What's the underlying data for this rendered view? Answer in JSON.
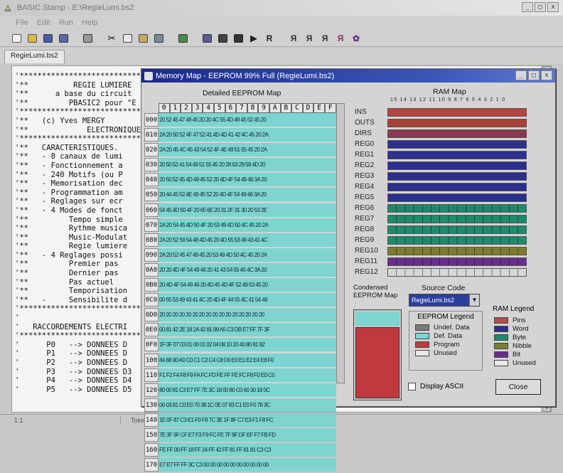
{
  "window": {
    "title": "BASIC Stamp - E:\\RegieLumi.bs2",
    "min": "_",
    "max": "□",
    "close": "x"
  },
  "menu": [
    "File",
    "Edit",
    "Run",
    "Help"
  ],
  "tab": "RegieLumi.bs2",
  "code_lines": [
    "'*****************************************",
    "'**          REGIE LUMIERE",
    "'**      a base du circuit",
    "'**         PBASIC2 pour \"E",
    "'*****************************************",
    "'**   (c) Yves MERGY",
    "'**             ELECTRONIQUE",
    "'*****************************************",
    "'**   CARACTERISTIQUES.",
    "'**   - 8 canaux de lumi",
    "'**   - Fonctionnement a",
    "'**   - 240 Motifs (ou P",
    "'**   - Memorisation dec",
    "'**   - Programmation am",
    "'**   - Reglages sur ecr",
    "'**   - 4 Modes de fonct",
    "'**         Tempo simple",
    "'**         Rythme musica",
    "'**         Music-Modulat",
    "'**         Regie lumiere",
    "'**   - 4 Reglages possi",
    "'**         Premier pas",
    "'**         Dernier pas",
    "'**         Pas actuel",
    "'**         Temporisation",
    "'**   -     Sensibilite d",
    "'*****************************************",
    "'",
    "'   RACCORDEMENTS ELECTRI",
    "'*****************************************",
    "'      P0   --> DONNEES D",
    "'      P1   --> DONNEES D",
    "'      P2   --> DONNEES D",
    "'      P3   --> DONNEES D3",
    "'      P4   --> DONNEES D4",
    "'      P5   --> DONNEES D5"
  ],
  "status": {
    "position": "1:1",
    "message": "Tokenize Successful"
  },
  "dialog": {
    "title": "Memory Map - EEPROM 99% Full (RegieLumi.bs2)",
    "detailed_label": "Detailed EEPROM Map",
    "ram_label": "RAM Map",
    "condensed_label": "Condensed EEPROM Map",
    "source_label": "Source Code",
    "source_value": "RegieLumi.bs2",
    "display_ascii": "Display ASCII",
    "close": "Close",
    "hex_columns": [
      "0",
      "1",
      "2",
      "3",
      "4",
      "5",
      "6",
      "7",
      "8",
      "9",
      "A",
      "B",
      "C",
      "D",
      "E",
      "F"
    ],
    "hex_rows": [
      {
        "addr": "000",
        "bytes": "20 52 45 47 49 45 20 20 4C 55 4D 49 45 52 45 20"
      },
      {
        "addr": "010",
        "bytes": "2A 20 50 52 4F 47 52 41 4D 4D 41 42 4C 45 20 2A"
      },
      {
        "addr": "020",
        "bytes": "2A 20 45 4C 45 43 54 52 4F 4E 49 51 55 45 20 2A"
      },
      {
        "addr": "030",
        "bytes": "20 50 52 41 54 49 51 55 45 20 28 63 29 59 4D 20"
      },
      {
        "addr": "040",
        "bytes": "20 50 52 45 4D 49 45 52 20 4D 4F 54 49 46 3A 20"
      },
      {
        "addr": "050",
        "bytes": "20 44 45 52 4E 49 45 52 20 4D 4F 54 49 46 3A 20"
      },
      {
        "addr": "060",
        "bytes": "54 45 4D 50 4F 20 65 6E 20 31 2F 31 30 20 53 2E"
      },
      {
        "addr": "070",
        "bytes": "2A 20 54 45 4D 50 4F 20 53 49 4D 50 4C 45 20 2A"
      },
      {
        "addr": "080",
        "bytes": "2A 20 52 59 54 48 4D 45 20 4D 55 53 49 43 41 4C"
      },
      {
        "addr": "090",
        "bytes": "2A 20 52 45 47 49 45 20 53 49 4D 50 4C 45 20 2A"
      },
      {
        "addr": "0A0",
        "bytes": "20 20 4D 4F 54 49 46 20 41 43 54 55 45 4C 3A 20"
      },
      {
        "addr": "0B0",
        "bytes": "20 4D 4F 54 49 46 20 4D 45 4D 4F 52 49 53 45 20"
      },
      {
        "addr": "0C0",
        "bytes": "00 55 53 49 43 41 4C 20 4D 4F 44 55 4C 41 54 49"
      },
      {
        "addr": "0D0",
        "bytes": "20 20 20 20 20 20 20 20 20 20 20 20 20 20 20 20"
      },
      {
        "addr": "0E0",
        "bytes": "00 81 42 2E 18 2A 42 81 99 A5 C3 DB E7 FF 7F 3F"
      },
      {
        "addr": "0F0",
        "bytes": "1F 0F 07 03 01 00 01 02 04 08 10 20 40 80 81 82"
      },
      {
        "addr": "100",
        "bytes": "84 88 90 A0 C0 C1 C2 C4 C8 D0 E0 E1 E2 E4 E8 F0"
      },
      {
        "addr": "110",
        "bytes": "F1 F2 F4 F8 F9 FA FC FD FE FF FE FC F8 F0 E0 C0"
      },
      {
        "addr": "120",
        "bytes": "80 00 81 C3 E7 FF 7E 3C 18 00 80 C0 60 30 18 0C"
      },
      {
        "addr": "130",
        "bytes": "06 03 81 C0 E0 70 38 1C 0E 07 83 C1 E0 F0 78 3C"
      },
      {
        "addr": "140",
        "bytes": "1E 0F 87 C3 E1 F0 F8 7C 3E 1F 8F C7 E3 F1 F8 FC"
      },
      {
        "addr": "150",
        "bytes": "7E 3F 9F CF E7 F3 F9 FC FE 7F 9F DF EF F7 FB FD"
      },
      {
        "addr": "160",
        "bytes": "FE FF 00 FF 18 FF 24 FF 42 FF 81 FF 81 81 C3 C3"
      },
      {
        "addr": "170",
        "bytes": "E7 E7 FF FF 3C C3 00 00 00 00 00 00 00 00 00 00"
      }
    ],
    "ram_bit_numbers": "15 14 13 12 11 10 9 8 7 6 5 4 3 2 1 0",
    "ram_rows": [
      {
        "label": "INS",
        "color": "#b8443f",
        "cells": false
      },
      {
        "label": "OUTS",
        "color": "#a84238",
        "cells": false
      },
      {
        "label": "DIRS",
        "color": "#8a3a4e",
        "cells": false
      },
      {
        "label": "REG0",
        "color": "#2b2f8e",
        "cells": false
      },
      {
        "label": "REG1",
        "color": "#2b2f8e",
        "cells": false
      },
      {
        "label": "REG2",
        "color": "#2b2f8e",
        "cells": false
      },
      {
        "label": "REG3",
        "color": "#2b2f8e",
        "cells": false
      },
      {
        "label": "REG4",
        "color": "#2b2f8e",
        "cells": false
      },
      {
        "label": "REG5",
        "color": "#2b2f8e",
        "cells": false
      },
      {
        "label": "REG6",
        "color": "#1f8a6e",
        "cells": true
      },
      {
        "label": "REG7",
        "color": "#1f8a6e",
        "cells": true
      },
      {
        "label": "REG8",
        "color": "#1f8a6e",
        "cells": true
      },
      {
        "label": "REG9",
        "color": "#1f8a6e",
        "cells": true
      },
      {
        "label": "REG10",
        "color": "#7d7d32",
        "cells": true
      },
      {
        "label": "REG11",
        "color": "#6a2d8e",
        "cells": true
      },
      {
        "label": "REG12",
        "color": "#d8d8d8",
        "cells": true
      }
    ],
    "eeprom_legend": {
      "title": "EEPROM Legend",
      "items": [
        {
          "label": "Undef. Data",
          "color": "#7a7a7a"
        },
        {
          "label": "Def. Data",
          "color": "#7ed4d0"
        },
        {
          "label": "Program",
          "color": "#c0393c"
        },
        {
          "label": "Unused",
          "color": "#e8e8e8"
        }
      ]
    },
    "ram_legend": {
      "title": "RAM Legend",
      "items": [
        {
          "label": "Pins",
          "color": "#b84a4a"
        },
        {
          "label": "Word",
          "color": "#2b2f8e"
        },
        {
          "label": "Byte",
          "color": "#1f8a6e"
        },
        {
          "label": "Nibble",
          "color": "#7d7d32"
        },
        {
          "label": "Bit",
          "color": "#6a2d8e"
        },
        {
          "label": "Unused",
          "color": "#e8e8e8"
        }
      ]
    }
  }
}
